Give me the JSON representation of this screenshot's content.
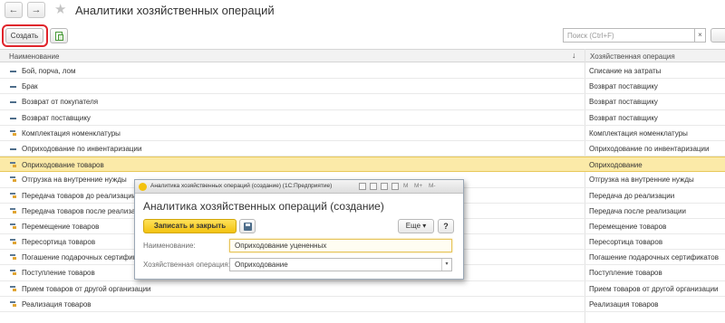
{
  "header": {
    "back_icon": "arrow-left-icon",
    "forward_icon": "arrow-right-icon",
    "favorite_icon": "star-icon",
    "title": "Аналитики хозяйственных операций"
  },
  "toolbar": {
    "create_label": "Создать",
    "search_placeholder": "Поиск (Ctrl+F)",
    "clear_glyph": "×"
  },
  "table": {
    "columns": [
      "Наименование",
      "Хозяйственная операция"
    ],
    "sort_glyph": "↓",
    "rows": [
      {
        "name": "Бой, порча, лом",
        "operation": "Списание на затраты",
        "icon": "item-icon"
      },
      {
        "name": "Брак",
        "operation": "Возврат поставщику",
        "icon": "item-icon"
      },
      {
        "name": "Возврат от покупателя",
        "operation": "Возврат поставщику",
        "icon": "item-icon"
      },
      {
        "name": "Возврат поставщику",
        "operation": "Возврат поставщику",
        "icon": "item-icon"
      },
      {
        "name": "Комплектация номенклатуры",
        "operation": "Комплектация номенклатуры",
        "icon": "predefined-item-icon"
      },
      {
        "name": "Оприходование по инвентаризации",
        "operation": "Оприходование по инвентаризации",
        "icon": "item-icon"
      },
      {
        "name": "Оприходование товаров",
        "operation": "Оприходование",
        "icon": "predefined-item-icon",
        "selected": true
      },
      {
        "name": "Отгрузка на внутренние нужды",
        "operation": "Отгрузка на внутренние нужды",
        "icon": "predefined-item-icon"
      },
      {
        "name": "Передача товаров до реализации",
        "operation": "Передача до реализации",
        "icon": "predefined-item-icon"
      },
      {
        "name": "Передача товаров после реализаци",
        "operation": "Передача после реализации",
        "icon": "predefined-item-icon"
      },
      {
        "name": "Перемещение товаров",
        "operation": "Перемещение товаров",
        "icon": "predefined-item-icon"
      },
      {
        "name": "Пересортица товаров",
        "operation": "Пересортица товаров",
        "icon": "predefined-item-icon"
      },
      {
        "name": "Погашение подарочных сертификат",
        "operation": "Погашение подарочных сертификатов",
        "icon": "predefined-item-icon"
      },
      {
        "name": "Поступление товаров",
        "operation": "Поступление товаров",
        "icon": "predefined-item-icon"
      },
      {
        "name": "Прием товаров от другой организации",
        "operation": "Прием товаров от другой организации",
        "icon": "predefined-item-icon"
      },
      {
        "name": "Реализация товаров",
        "operation": "Реализация товаров",
        "icon": "predefined-item-icon"
      }
    ]
  },
  "dialog": {
    "window_title": "Аналитика хозяйственных операций (создание) (1С:Предприятие)",
    "window_tools": [
      "M",
      "M+",
      "M-"
    ],
    "title": "Аналитика хозяйственных операций (создание)",
    "save_close_label": "Записать и закрыть",
    "more_label": "Еще ▾",
    "help_label": "?",
    "name_label": "Наименование:",
    "name_value": "Оприходование уцененных",
    "operation_label": "Хозяйственная операция:",
    "operation_value": "Оприходование",
    "dropdown_glyph": "▾"
  },
  "colors": {
    "highlight_border": "#e0242b",
    "selected_row": "#fbeaa8",
    "primary_button": "#f3c20f"
  }
}
